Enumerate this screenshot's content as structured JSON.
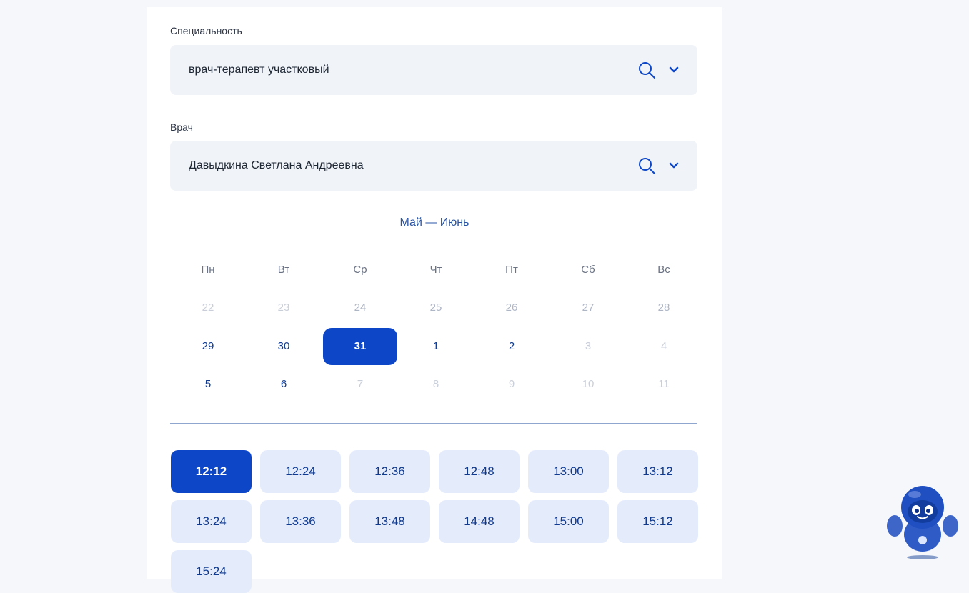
{
  "specialty": {
    "label": "Специальность",
    "value": "врач-терапевт участковый"
  },
  "doctor": {
    "label": "Врач",
    "value": "Давыдкина Светлана Андреевна"
  },
  "calendar": {
    "month_label": "Май — Июнь",
    "weekdays": [
      "Пн",
      "Вт",
      "Ср",
      "Чт",
      "Пт",
      "Сб",
      "Вс"
    ],
    "weeks": [
      [
        "22",
        "23",
        "24",
        "25",
        "26",
        "27",
        "28"
      ],
      [
        "29",
        "30",
        "31",
        "1",
        "2",
        "3",
        "4"
      ],
      [
        "5",
        "6",
        "7",
        "8",
        "9",
        "10",
        "11"
      ]
    ],
    "selected_day": "31"
  },
  "time_slots": [
    "12:12",
    "12:24",
    "12:36",
    "12:48",
    "13:00",
    "13:12",
    "13:24",
    "13:36",
    "13:48",
    "14:48",
    "15:00",
    "15:12",
    "15:24"
  ],
  "selected_slot": "12:12",
  "colors": {
    "accent": "#0d47c8",
    "slot_bg": "#e4ebfb",
    "field_bg": "#f0f3f8",
    "page_bg": "#f5f7fb"
  },
  "icons": {
    "field_search": "search-icon",
    "field_dropdown": "chevron-down-icon",
    "assistant": "robot-assistant-icon"
  }
}
